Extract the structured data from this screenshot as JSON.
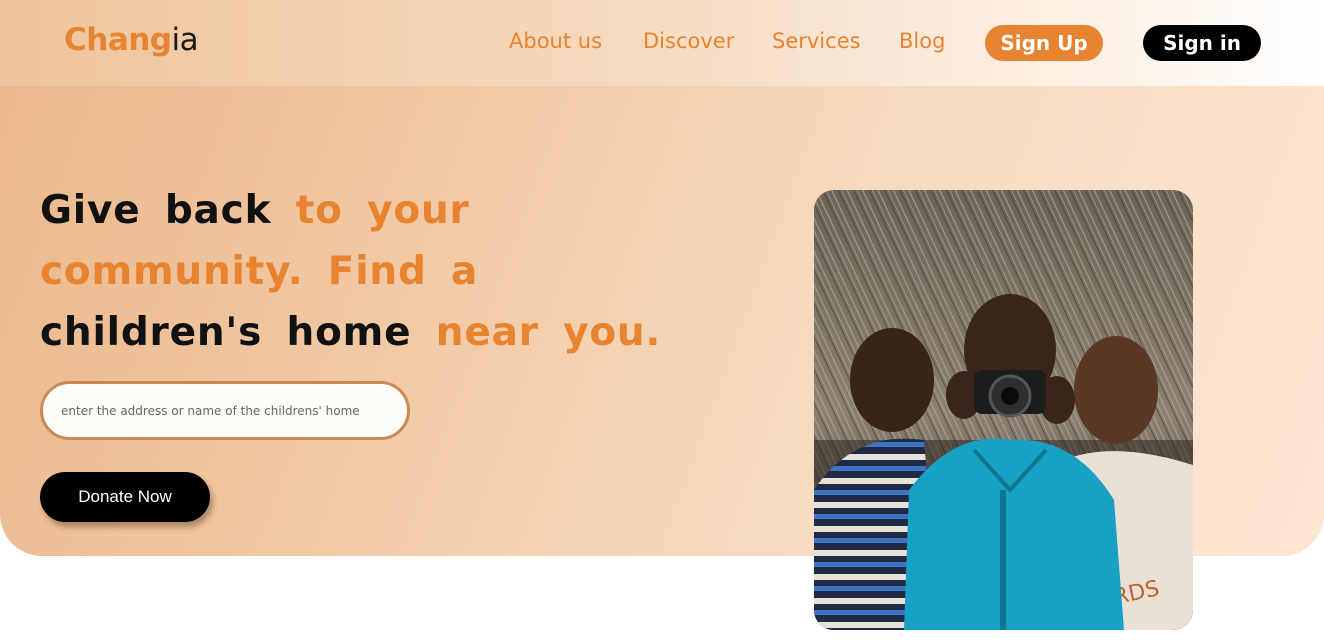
{
  "brand": {
    "name_part1": "Chang",
    "name_part2": "ia"
  },
  "nav": {
    "about": "About us",
    "discover": "Discover",
    "services": "Services",
    "blog": "Blog",
    "signup": "Sign Up",
    "signin": "Sign in"
  },
  "hero": {
    "headline": {
      "w1": "Give back",
      "w2": "to your community.",
      "w3": "Find a",
      "w4": "children's home",
      "w5": "near you."
    },
    "search": {
      "placeholder": "enter the address or name of the childrens' home",
      "value": ""
    },
    "donate_label": "Donate Now"
  },
  "colors": {
    "accent": "#e8832f",
    "dark": "#000000",
    "hero_bg": "#f2cba8"
  }
}
